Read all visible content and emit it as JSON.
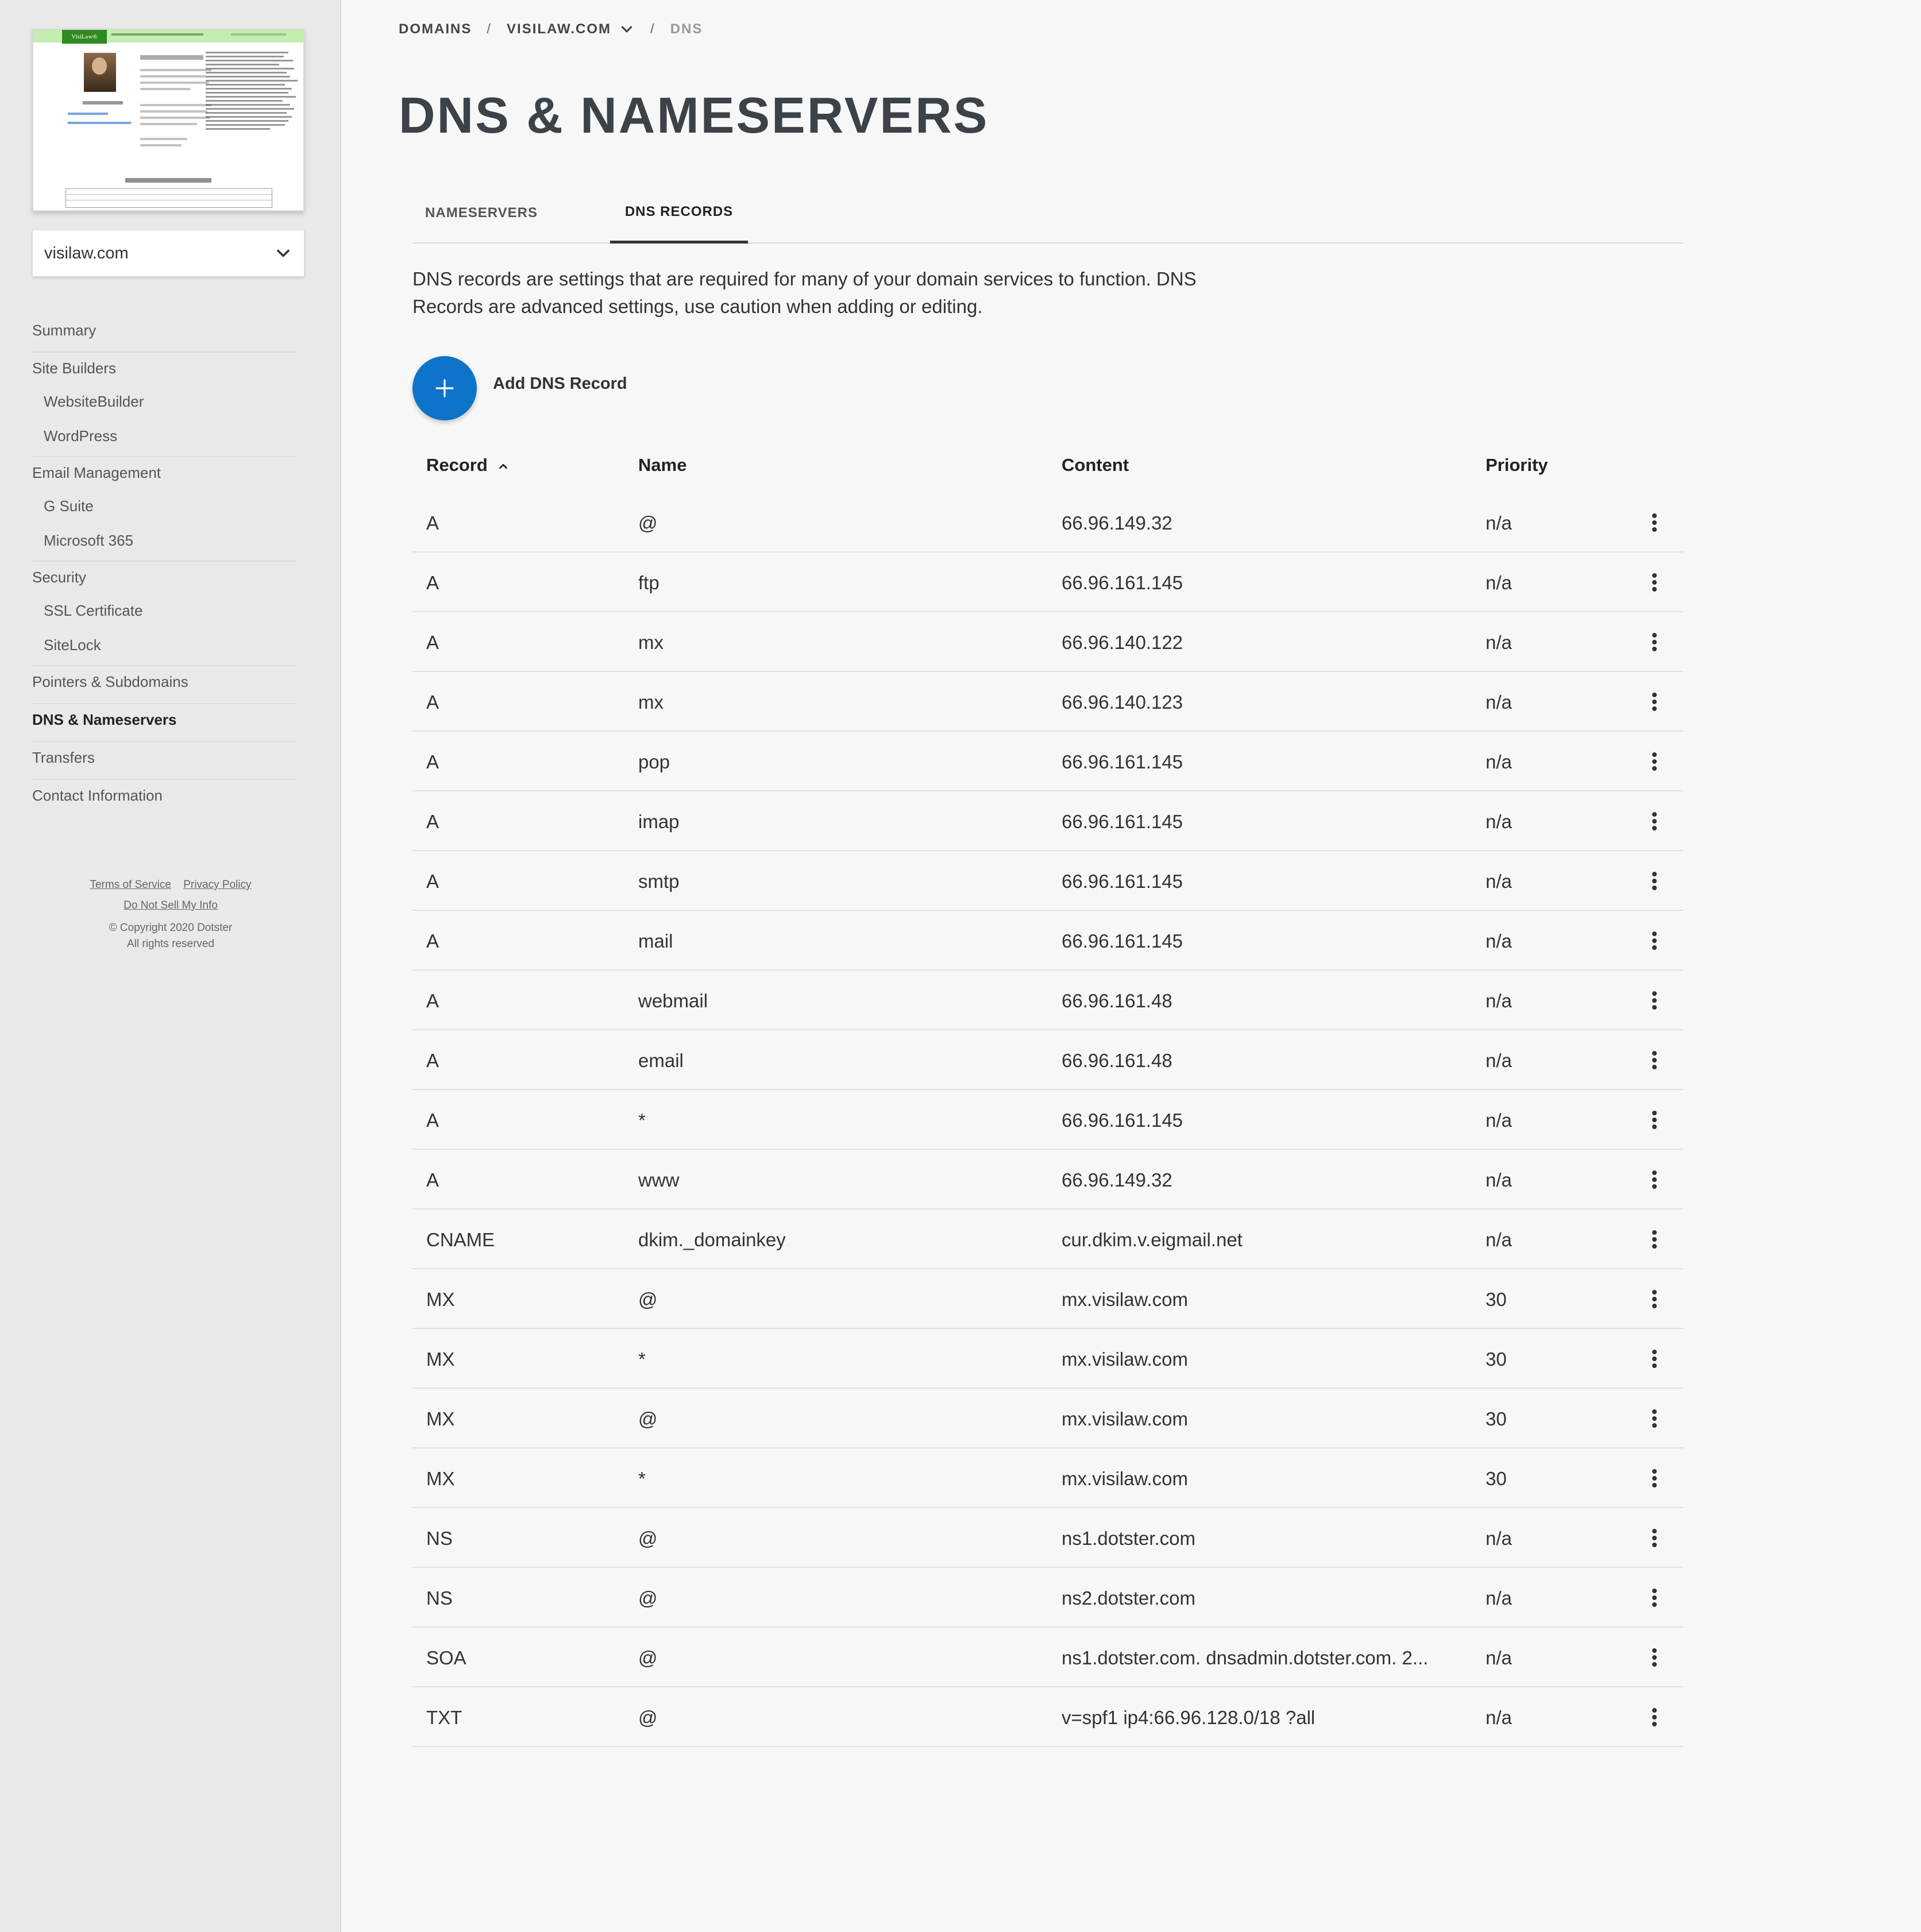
{
  "sidebar": {
    "domain_select": {
      "value": "visilaw.com",
      "icon": "chevron-down-icon"
    },
    "nav": {
      "summary": "Summary",
      "site_builders": "Site Builders",
      "website_builder": "WebsiteBuilder",
      "wordpress": "WordPress",
      "email_management": "Email Management",
      "g_suite": "G Suite",
      "microsoft_365": "Microsoft 365",
      "security": "Security",
      "ssl_certificate": "SSL Certificate",
      "sitelock": "SiteLock",
      "pointers_subdomains": "Pointers & Subdomains",
      "dns_nameservers": "DNS & Nameservers",
      "transfers": "Transfers",
      "contact_information": "Contact Information"
    },
    "footer": {
      "terms": "Terms of Service",
      "privacy": "Privacy Policy",
      "do_not_sell": "Do Not Sell My Info",
      "copyright": "© Copyright 2020 Dotster",
      "rights": "All rights reserved"
    }
  },
  "breadcrumb": {
    "domains": "DOMAINS",
    "separator": "/",
    "domain": "VISILAW.COM",
    "current": "DNS"
  },
  "page_title": "DNS & NAMESERVERS",
  "tabs": [
    {
      "label": "NAMESERVERS",
      "active": false
    },
    {
      "label": "DNS RECORDS",
      "active": true
    }
  ],
  "intro_line1": "DNS records are settings that are required for many of your domain services to function. DNS",
  "intro_line2": "Records are advanced settings, use caution when adding or editing.",
  "add_button": {
    "label": "Add DNS Record",
    "icon": "plus-icon"
  },
  "table": {
    "headers": {
      "record": "Record",
      "name": "Name",
      "content": "Content",
      "priority": "Priority"
    },
    "sort_icon": "chevron-up-icon",
    "rows": [
      {
        "record": "A",
        "name": "@",
        "content": "66.96.149.32",
        "priority": "n/a"
      },
      {
        "record": "A",
        "name": "ftp",
        "content": "66.96.161.145",
        "priority": "n/a"
      },
      {
        "record": "A",
        "name": "mx",
        "content": "66.96.140.122",
        "priority": "n/a"
      },
      {
        "record": "A",
        "name": "mx",
        "content": "66.96.140.123",
        "priority": "n/a"
      },
      {
        "record": "A",
        "name": "pop",
        "content": "66.96.161.145",
        "priority": "n/a"
      },
      {
        "record": "A",
        "name": "imap",
        "content": "66.96.161.145",
        "priority": "n/a"
      },
      {
        "record": "A",
        "name": "smtp",
        "content": "66.96.161.145",
        "priority": "n/a"
      },
      {
        "record": "A",
        "name": "mail",
        "content": "66.96.161.145",
        "priority": "n/a"
      },
      {
        "record": "A",
        "name": "webmail",
        "content": "66.96.161.48",
        "priority": "n/a"
      },
      {
        "record": "A",
        "name": "email",
        "content": "66.96.161.48",
        "priority": "n/a"
      },
      {
        "record": "A",
        "name": "*",
        "content": "66.96.161.145",
        "priority": "n/a"
      },
      {
        "record": "A",
        "name": "www",
        "content": "66.96.149.32",
        "priority": "n/a"
      },
      {
        "record": "CNAME",
        "name": "dkim._domainkey",
        "content": "cur.dkim.v.eigmail.net",
        "priority": "n/a"
      },
      {
        "record": "MX",
        "name": "@",
        "content": "mx.visilaw.com",
        "priority": "30"
      },
      {
        "record": "MX",
        "name": "*",
        "content": "mx.visilaw.com",
        "priority": "30"
      },
      {
        "record": "MX",
        "name": "@",
        "content": "mx.visilaw.com",
        "priority": "30"
      },
      {
        "record": "MX",
        "name": "*",
        "content": "mx.visilaw.com",
        "priority": "30"
      },
      {
        "record": "NS",
        "name": "@",
        "content": "ns1.dotster.com",
        "priority": "n/a"
      },
      {
        "record": "NS",
        "name": "@",
        "content": "ns2.dotster.com",
        "priority": "n/a"
      },
      {
        "record": "SOA",
        "name": "@",
        "content": "ns1.dotster.com. dnsadmin.dotster.com. 2...",
        "priority": "n/a"
      },
      {
        "record": "TXT",
        "name": "@",
        "content": "v=spf1 ip4:66.96.128.0/18 ?all",
        "priority": "n/a"
      }
    ],
    "row_action_icon": "more-vertical-icon"
  },
  "colors": {
    "accent": "#0d74c9",
    "sidebar_bg": "#e9e9ea",
    "page_bg": "#f7f7f7",
    "title": "#3c4248"
  }
}
